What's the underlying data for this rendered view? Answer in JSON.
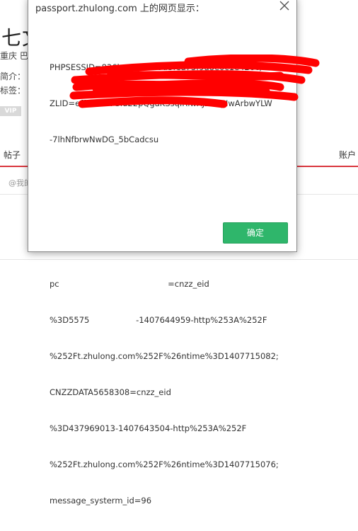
{
  "background": {
    "title": "七文",
    "location": "重庆 巴",
    "intro_label": "简介：",
    "tags_label": "标签：",
    "vip_badge": "VIP",
    "tab_posts": "帖子",
    "tab_account": "账户",
    "mine_text": "@我的"
  },
  "dialog": {
    "title": "passport.zhulong.com 上的网页显示：",
    "message_lines": [
      "PHPSESSID=836ba54c4759a3fea73f9a8e0c1e426c;",
      "ZLID=eff8CoelTGIu22pQgaKSsqIRlwXJZ05pIwArbwYLW",
      "-7lhNfbrwNwDG_5bCadcsu",
      "",
      "",
      "",
      "pc                                          =cnzz_eid",
      "%3D5575                  -1407644959-http%253A%252F",
      "%252Ft.zhulong.com%252F%26ntime%3D1407715082;",
      "CNZZDATA5658308=cnzz_eid",
      "%3D437969013-1407643504-http%253A%252F",
      "%252Ft.zhulong.com%252F%26ntime%3D1407715076;",
      "message_systerm_id=96"
    ],
    "ok_label": "确定"
  },
  "colors": {
    "ok_button": "#2fb66b",
    "redaction": "#ff0000",
    "accent_line": "#d9363e"
  },
  "icons": {
    "close": "close-icon"
  }
}
